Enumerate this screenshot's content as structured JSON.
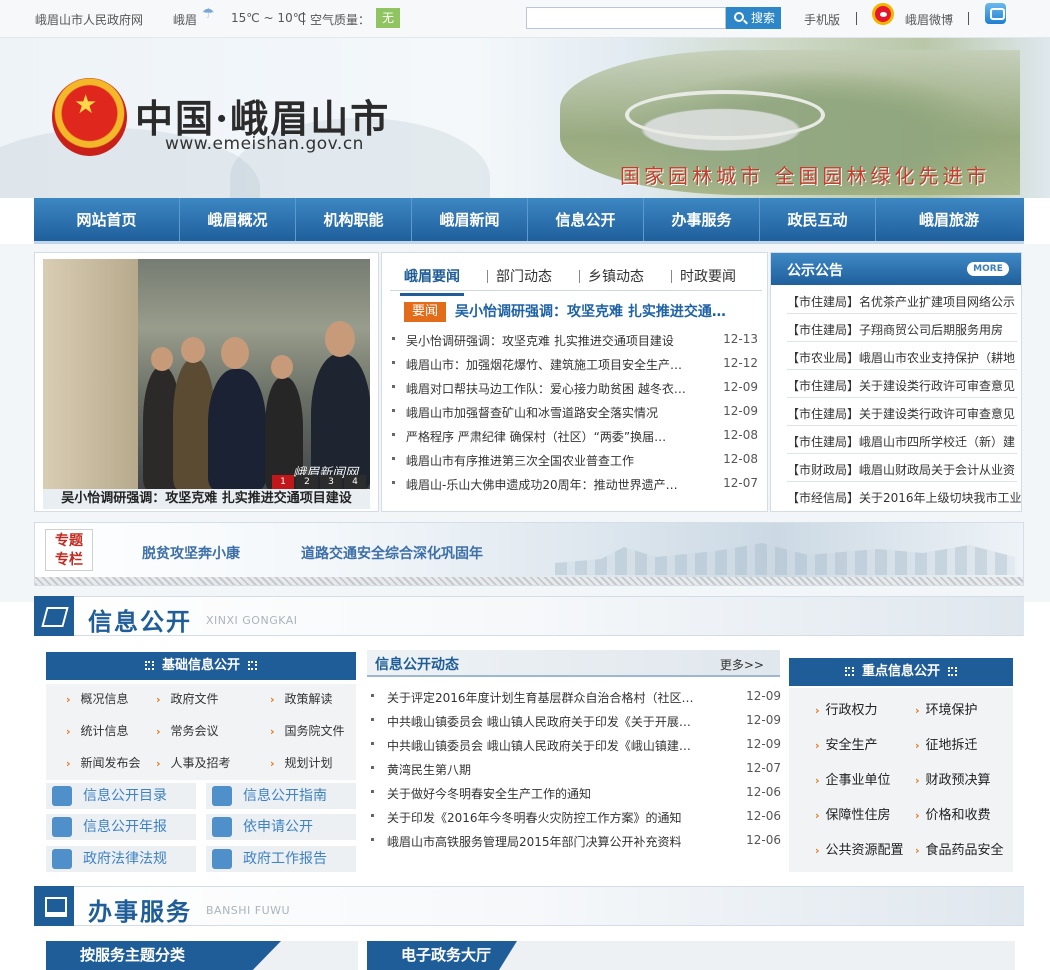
{
  "topbar": {
    "site_name": "峨眉山市人民政府网",
    "weather_city": "峨眉",
    "weather_temp": "15℃ ~ 10℃",
    "air_quality_label": "空气质量：",
    "air_quality_value": "无",
    "search_placeholder": "",
    "search_button": "搜索",
    "mobile_link": "手机版",
    "weibo_link": "峨眉微博"
  },
  "header": {
    "title": "中国·峨眉山市",
    "url": "www.emeishan.gov.cn",
    "slogan": "国家园林城市  全国园林绿化先进市"
  },
  "nav": {
    "items": [
      "网站首页",
      "峨眉概况",
      "机构职能",
      "峨眉新闻",
      "信息公开",
      "办事服务",
      "政民互动",
      "峨眉旅游"
    ]
  },
  "photo_news": {
    "caption": "吴小怡调研强调：攻坚克难 扎实推进交通项目建设",
    "watermark": "峨眉新闻网",
    "pages": [
      "1",
      "2",
      "3",
      "4"
    ]
  },
  "news": {
    "tabs": [
      "峨眉要闻",
      "部门动态",
      "乡镇动态",
      "时政要闻"
    ],
    "badge": "要闻",
    "headline": "吴小怡调研强调：攻坚克难 扎实推进交通…",
    "items": [
      {
        "title": "吴小怡调研强调：攻坚克难 扎实推进交通项目建设",
        "date": "12-13"
      },
      {
        "title": "峨眉山市：加强烟花爆竹、建筑施工项目安全生产…",
        "date": "12-12"
      },
      {
        "title": "峨眉对口帮扶马边工作队：爱心接力助贫困 越冬衣…",
        "date": "12-09"
      },
      {
        "title": "峨眉山市加强督查矿山和冰雪道路安全落实情况",
        "date": "12-09"
      },
      {
        "title": "严格程序 严肃纪律 确保村（社区）“两委”换届…",
        "date": "12-08"
      },
      {
        "title": "峨眉山市有序推进第三次全国农业普查工作",
        "date": "12-08"
      },
      {
        "title": "峨眉山-乐山大佛申遗成功20周年：推动世界遗产…",
        "date": "12-07"
      }
    ]
  },
  "notice": {
    "title": "公示公告",
    "more": "MORE",
    "items": [
      "【市住建局】名优茶产业扩建项目网络公示",
      "【市住建局】子翔商贸公司后期服务用房",
      "【市农业局】峨眉山市农业支持保护（耕地",
      "【市住建局】关于建设类行政许可审查意见",
      "【市住建局】关于建设类行政许可审查意见",
      "【市住建局】峨眉山市四所学校迁（新）建",
      "【市财政局】峨眉山财政局关于会计从业资",
      "【市经信局】关于2016年上级切块我市工业"
    ]
  },
  "special": {
    "badge_line1": "专题",
    "badge_line2": "专栏",
    "links": [
      "脱贫攻坚奔小康",
      "道路交通安全综合深化巩固年"
    ]
  },
  "info_public": {
    "title": "信息公开",
    "subtitle": "XINXI GONGKAI",
    "basic_title": "基础信息公开",
    "basic_items": [
      "概况信息",
      "政府文件",
      "政策解读",
      "统计信息",
      "常务会议",
      "国务院文件",
      "新闻发布会",
      "人事及招考",
      "规划计划"
    ],
    "quick_links": [
      "信息公开目录",
      "信息公开指南",
      "信息公开年报",
      "依申请公开",
      "政府法律法规",
      "政府工作报告"
    ],
    "dynamic_title": "信息公开动态",
    "dynamic_more": "更多>>",
    "dynamic_items": [
      {
        "title": "关于评定2016年度计划生育基层群众自治合格村（社区…",
        "date": "12-09"
      },
      {
        "title": "中共峨山镇委员会 峨山镇人民政府关于印发《关于开展…",
        "date": "12-09"
      },
      {
        "title": "中共峨山镇委员会 峨山镇人民政府关于印发《峨山镇建…",
        "date": "12-09"
      },
      {
        "title": "黄湾民生第八期",
        "date": "12-07"
      },
      {
        "title": "关于做好今冬明春安全生产工作的通知",
        "date": "12-06"
      },
      {
        "title": "关于印发《2016年今冬明春火灾防控工作方案》的通知",
        "date": "12-06"
      },
      {
        "title": "峨眉山市高铁服务管理局2015年部门决算公开补充资料",
        "date": "12-06"
      }
    ],
    "key_title": "重点信息公开",
    "key_items": [
      "行政权力",
      "环境保护",
      "安全生产",
      "征地拆迁",
      "企事业单位",
      "财政预决算",
      "保障性住房",
      "价格和收费",
      "公共资源配置",
      "食品药品安全"
    ]
  },
  "service": {
    "title": "办事服务",
    "subtitle": "BANSHI FUWU",
    "tabs": [
      "按服务主题分类",
      "电子政务大厅"
    ]
  },
  "colors": {
    "primary_blue": "#1f5d98",
    "accent_orange": "#e26c1a",
    "air_quality_green": "#8fc461"
  }
}
